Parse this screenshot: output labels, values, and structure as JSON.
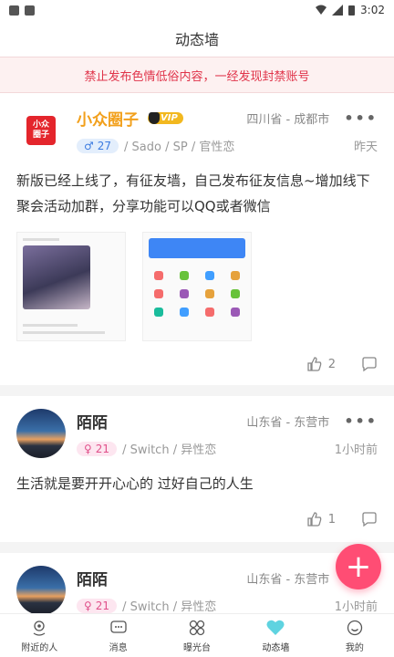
{
  "status_bar": {
    "time": "3:02"
  },
  "header": {
    "title": "动态墙"
  },
  "notice": {
    "text": "禁止发布色情低俗内容，一经发现封禁账号"
  },
  "posts": [
    {
      "name": "小众圈子",
      "vip": "VIP",
      "avatar_text": [
        "小众",
        "圈子"
      ],
      "location": "四川省 - 成都市",
      "gender_symbol": "♂",
      "age": "27",
      "tags": "/ Sado / SP / 官性恋",
      "time": "昨天",
      "content": "新版已经上线了，有征友墙，自己发布征友信息~增加线下聚会活动加群，分享功能可以QQ或者微信",
      "likes": "2"
    },
    {
      "name": "陌陌",
      "location": "山东省 - 东营市",
      "gender_symbol": "♀",
      "age": "21",
      "tags": "/ Switch / 异性恋",
      "time": "1小时前",
      "content": "生活就是要开开心心的 过好自己的人生",
      "likes": "1"
    },
    {
      "name": "陌陌",
      "location": "山东省 - 东营市",
      "gender_symbol": "♀",
      "age": "21",
      "tags": "/ Switch / 异性恋",
      "time": "1小时前"
    }
  ],
  "fab": {
    "label": "+"
  },
  "nav": [
    {
      "label": "附近的人",
      "icon": "nearby-icon"
    },
    {
      "label": "消息",
      "icon": "message-icon"
    },
    {
      "label": "曝光台",
      "icon": "exposure-icon"
    },
    {
      "label": "动态墙",
      "icon": "heart-icon"
    },
    {
      "label": "我的",
      "icon": "profile-icon"
    }
  ],
  "colors": {
    "accent": "#ff4d74",
    "notice": "#e0344a",
    "vip": "#f2a01c"
  }
}
